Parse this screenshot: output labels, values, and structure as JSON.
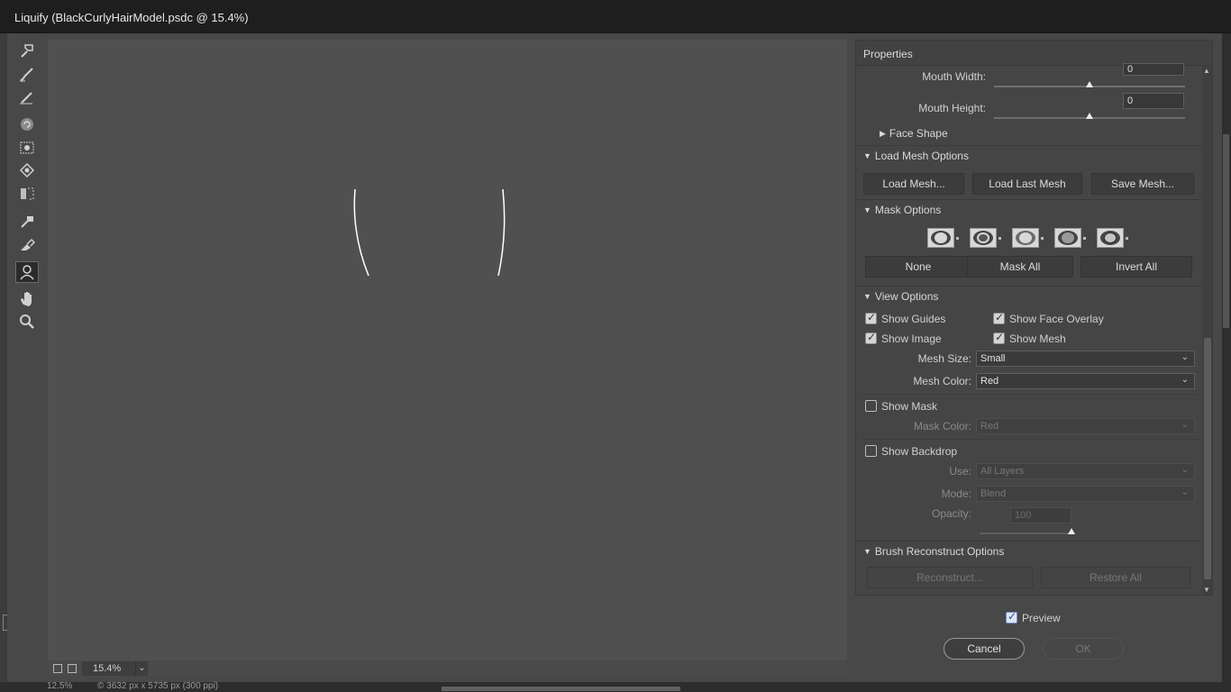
{
  "window": {
    "title": "Liquify (BlackCurlyHairModel.psdc @ 15.4%)"
  },
  "toolbar": {
    "tools": [
      "forward-warp",
      "reconstruct",
      "smooth",
      "twirl-clockwise",
      "pucker",
      "bloat",
      "push-left",
      "freeze-mask",
      "thaw-mask",
      "face",
      "hand",
      "zoom"
    ],
    "active_tool": "face"
  },
  "canvas_footer": {
    "zoom": "15.4%"
  },
  "properties": {
    "header": "Properties",
    "face_aware": {
      "mouth_width_label": "Mouth Width:",
      "mouth_width_value": "0",
      "mouth_height_label": "Mouth Height:",
      "mouth_height_value": "0",
      "face_shape_label": "Face Shape"
    },
    "load_mesh": {
      "title": "Load Mesh Options",
      "load_mesh": "Load Mesh...",
      "load_last_mesh": "Load Last Mesh",
      "save_mesh": "Save Mesh..."
    },
    "mask": {
      "title": "Mask Options",
      "none": "None",
      "mask_all": "Mask All",
      "invert_all": "Invert All"
    },
    "view": {
      "title": "View Options",
      "show_guides": "Show Guides",
      "show_face_overlay": "Show Face Overlay",
      "show_image": "Show Image",
      "show_mesh": "Show Mesh",
      "mesh_size_label": "Mesh Size:",
      "mesh_size_value": "Small",
      "mesh_color_label": "Mesh Color:",
      "mesh_color_value": "Red",
      "show_mask": "Show Mask",
      "mask_color_label": "Mask Color:",
      "mask_color_value": "Red",
      "show_backdrop": "Show Backdrop",
      "use_label": "Use:",
      "use_value": "All Layers",
      "mode_label": "Mode:",
      "mode_value": "Blend",
      "opacity_label": "Opacity:",
      "opacity_value": "100"
    },
    "brush_reconstruct": {
      "title": "Brush Reconstruct Options",
      "reconstruct": "Reconstruct...",
      "restore_all": "Restore All"
    }
  },
  "footer": {
    "preview": "Preview",
    "cancel": "Cancel",
    "ok": "OK"
  },
  "status": {
    "zoom": "12.5%",
    "doc_info": "© 3632 px x 5735 px (300 ppi)"
  },
  "colors": {
    "background": "#484848",
    "canvas": "#505050",
    "panel": "#454545"
  }
}
